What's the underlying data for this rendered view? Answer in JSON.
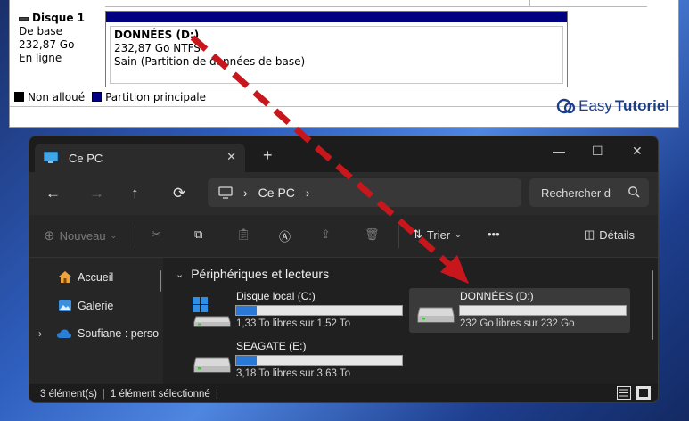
{
  "disk_management": {
    "disk": {
      "title": "Disque 1",
      "type": "De base",
      "size": "232,87 Go",
      "state": "En ligne"
    },
    "partition": {
      "title": "DONNÉES  (D:)",
      "size_fs": "232,87 Go NTFS",
      "status": "Sain (Partition de données de base)"
    },
    "legend": {
      "unallocated": "Non alloué",
      "primary": "Partition principale"
    },
    "colors": {
      "primary_partition": "#000080"
    }
  },
  "brand": {
    "name_part1": "Easy",
    "name_part2": "Tutoriel",
    "color": "#1b3d8a"
  },
  "explorer": {
    "tab": {
      "title": "Ce PC",
      "close": "✕"
    },
    "new_tab": "+",
    "window_controls": {
      "minimize": "—",
      "maximize": "☐",
      "close": "✕"
    },
    "address": {
      "location": "Ce PC",
      "separator": "›"
    },
    "search": {
      "placeholder": "Rechercher d"
    },
    "commands": {
      "new": "Nouveau",
      "sort": "Trier",
      "more": "•••",
      "details": "Détails"
    },
    "sidebar": [
      {
        "label": "Accueil",
        "icon": "home-icon"
      },
      {
        "label": "Galerie",
        "icon": "gallery-icon"
      },
      {
        "label": "Soufiane : perso",
        "icon": "cloud-icon"
      }
    ],
    "section": {
      "title": "Périphériques et lecteurs"
    },
    "drives": [
      {
        "name": "Disque local (C:)",
        "free": "1,33 To libres sur 1,52 To",
        "used_fraction": 0.125,
        "selected": false
      },
      {
        "name": "DONNÉES (D:)",
        "free": "232 Go libres sur 232 Go",
        "used_fraction": 0.0,
        "selected": true
      },
      {
        "name": "SEAGATE (E:)",
        "free": "3,18 To libres sur 3,63 To",
        "used_fraction": 0.125,
        "selected": false
      }
    ],
    "status": {
      "count": "3 élément(s)",
      "selected": "1 élément sélectionné",
      "divider": "|"
    },
    "colors": {
      "accent": "#2a79d6",
      "annotation_arrow": "#c8161d"
    }
  }
}
